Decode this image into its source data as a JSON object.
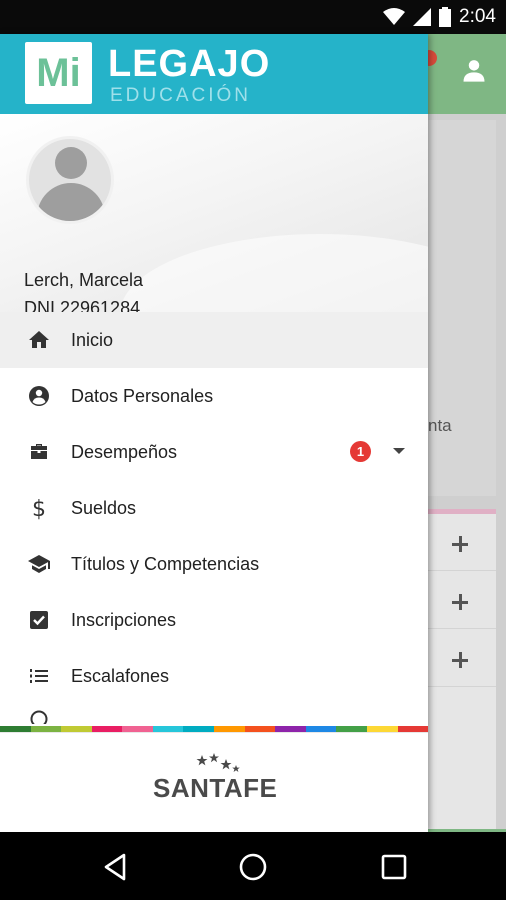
{
  "status_bar": {
    "time": "2:04",
    "icons": [
      "wifi-icon",
      "cell-signal-icon",
      "battery-icon"
    ]
  },
  "app": {
    "logo_badge": "Mi",
    "logo_title": "LEGAJO",
    "logo_subtitle": "EDUCACIÓN",
    "brand_color": "#25b3c9"
  },
  "profile": {
    "name": "Lerch, Marcela",
    "dni": "DNI 22961284"
  },
  "menu": {
    "items": [
      {
        "label": "Inicio",
        "icon": "home-icon",
        "active": true
      },
      {
        "label": "Datos Personales",
        "icon": "account-circle-icon"
      },
      {
        "label": "Desempeños",
        "icon": "briefcase-icon",
        "badge": "1"
      },
      {
        "label": "Sueldos",
        "icon": "dollar-icon"
      },
      {
        "label": "Títulos y Competencias",
        "icon": "graduation-cap-icon"
      },
      {
        "label": "Inscripciones",
        "icon": "checkbox-icon"
      },
      {
        "label": "Escalafones",
        "icon": "ordered-list-icon"
      }
    ]
  },
  "background": {
    "partial_text": "nta"
  },
  "footer": {
    "logo_text": "SANTAFE"
  },
  "nav_bar": {
    "buttons": [
      "back-icon",
      "home-circle-icon",
      "recents-icon"
    ]
  },
  "colors": {
    "badge_red": "#e53935",
    "toolbar_green": "#7fb784"
  }
}
